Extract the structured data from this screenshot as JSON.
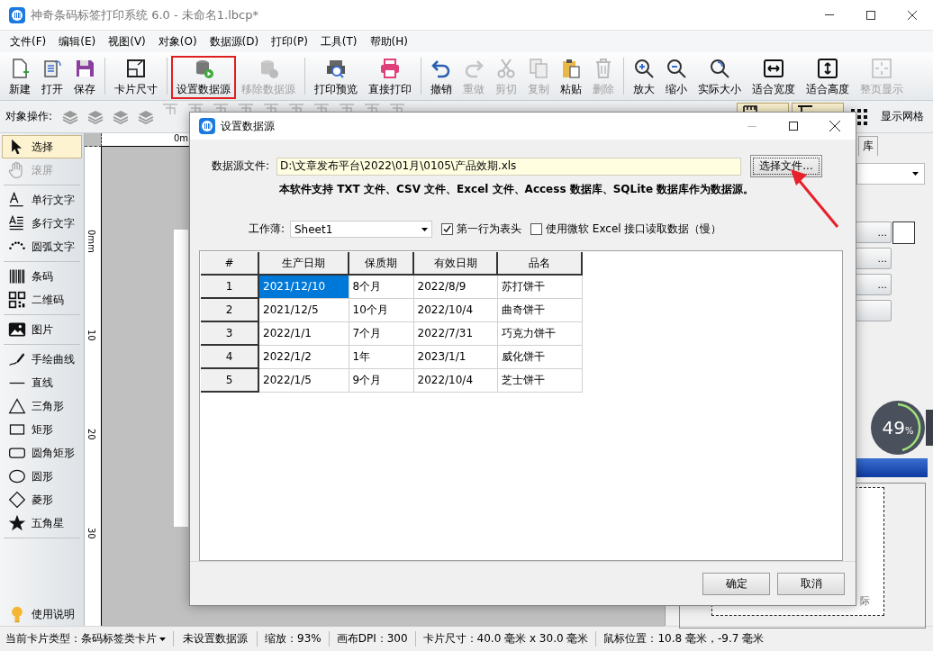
{
  "window": {
    "title": "神奇条码标签打印系统 6.0 - 未命名1.lbcp*"
  },
  "menu": [
    "文件(F)",
    "编辑(E)",
    "视图(V)",
    "对象(O)",
    "数据源(D)",
    "打印(P)",
    "工具(T)",
    "帮助(H)"
  ],
  "toolbar": {
    "groups": [
      [
        {
          "label": "新建",
          "disabled": false,
          "highlighted": false
        },
        {
          "label": "打开",
          "disabled": false,
          "highlighted": false
        },
        {
          "label": "保存",
          "disabled": false,
          "highlighted": false
        }
      ],
      [
        {
          "label": "卡片尺寸",
          "disabled": false,
          "highlighted": false
        }
      ],
      [
        {
          "label": "设置数据源",
          "disabled": false,
          "highlighted": true
        },
        {
          "label": "移除数据源",
          "disabled": true,
          "highlighted": false
        }
      ],
      [
        {
          "label": "打印预览",
          "disabled": false,
          "highlighted": false
        },
        {
          "label": "直接打印",
          "disabled": false,
          "highlighted": false
        }
      ],
      [
        {
          "label": "撤销",
          "disabled": false,
          "highlighted": false
        },
        {
          "label": "重做",
          "disabled": true,
          "highlighted": false
        },
        {
          "label": "剪切",
          "disabled": true,
          "highlighted": false
        },
        {
          "label": "复制",
          "disabled": true,
          "highlighted": false
        },
        {
          "label": "粘贴",
          "disabled": false,
          "highlighted": false
        },
        {
          "label": "删除",
          "disabled": true,
          "highlighted": false
        }
      ],
      [
        {
          "label": "放大",
          "disabled": false,
          "highlighted": false
        },
        {
          "label": "缩小",
          "disabled": false,
          "highlighted": false
        },
        {
          "label": "实际大小",
          "disabled": false,
          "highlighted": false
        },
        {
          "label": "适合宽度",
          "disabled": false,
          "highlighted": false
        },
        {
          "label": "适合高度",
          "disabled": false,
          "highlighted": false
        },
        {
          "label": "整页显示",
          "disabled": true,
          "highlighted": false
        }
      ]
    ]
  },
  "object_bar": {
    "label": "对象操作:",
    "toggles": [
      {
        "on": true
      },
      {
        "on": true
      }
    ],
    "grid_toggle": {
      "label": "显示网格",
      "on": false
    }
  },
  "tools": {
    "groups": [
      [
        {
          "label": "选择",
          "selected": true,
          "disabled": false
        },
        {
          "label": "滚屏",
          "selected": false,
          "disabled": true
        }
      ],
      [
        {
          "label": "单行文字",
          "selected": false,
          "disabled": false
        },
        {
          "label": "多行文字",
          "selected": false,
          "disabled": false
        },
        {
          "label": "圆弧文字",
          "selected": false,
          "disabled": false
        }
      ],
      [
        {
          "label": "条码",
          "selected": false,
          "disabled": false
        },
        {
          "label": "二维码",
          "selected": false,
          "disabled": false
        }
      ],
      [
        {
          "label": "图片",
          "selected": false,
          "disabled": false
        }
      ],
      [
        {
          "label": "手绘曲线",
          "selected": false,
          "disabled": false
        },
        {
          "label": "直线",
          "selected": false,
          "disabled": false
        },
        {
          "label": "三角形",
          "selected": false,
          "disabled": false
        },
        {
          "label": "矩形",
          "selected": false,
          "disabled": false
        },
        {
          "label": "圆角矩形",
          "selected": false,
          "disabled": false
        },
        {
          "label": "圆形",
          "selected": false,
          "disabled": false
        },
        {
          "label": "菱形",
          "selected": false,
          "disabled": false
        },
        {
          "label": "五角星",
          "selected": false,
          "disabled": false
        }
      ]
    ],
    "help": "使用说明"
  },
  "ruler": {
    "top_label": "0m",
    "side_labels": [
      "0mm",
      "10",
      "20",
      "30"
    ]
  },
  "right_panel": {
    "tab": "库",
    "buttons": [
      "...",
      "...",
      "..."
    ],
    "preview_text": "际"
  },
  "net_monitor": {
    "value": "49",
    "unit": "%"
  },
  "dialog": {
    "title": "设置数据源",
    "file_label": "数据源文件:",
    "file_path": "D:\\文章发布平台\\2022\\01月\\0105\\产品效期.xls",
    "choose_button": "选择文件...",
    "note": "本软件支持 TXT 文件、CSV 文件、Excel 文件、Access 数据库、SQLite 数据库作为数据源。",
    "workbook_label": "工作薄:",
    "workbook": "Sheet1",
    "options": [
      {
        "label": "第一行为表头",
        "checked": true
      },
      {
        "label": "使用微软 Excel 接口读取数据（慢）",
        "checked": false
      }
    ],
    "table": {
      "columns": [
        "#",
        "生产日期",
        "保质期",
        "有效日期",
        "品名"
      ],
      "rows": [
        {
          "cells": [
            {
              "text": "1",
              "selected": false
            },
            {
              "text": "2021/12/10",
              "selected": true
            },
            {
              "text": "8个月",
              "selected": false
            },
            {
              "text": "2022/8/9",
              "selected": false
            },
            {
              "text": "苏打饼干",
              "selected": false
            }
          ]
        },
        {
          "cells": [
            {
              "text": "2",
              "selected": false
            },
            {
              "text": "2021/12/5",
              "selected": false
            },
            {
              "text": "10个月",
              "selected": false
            },
            {
              "text": "2022/10/4",
              "selected": false
            },
            {
              "text": "曲奇饼干",
              "selected": false
            }
          ]
        },
        {
          "cells": [
            {
              "text": "3",
              "selected": false
            },
            {
              "text": "2022/1/1",
              "selected": false
            },
            {
              "text": "7个月",
              "selected": false
            },
            {
              "text": "2022/7/31",
              "selected": false
            },
            {
              "text": "巧克力饼干",
              "selected": false
            }
          ]
        },
        {
          "cells": [
            {
              "text": "4",
              "selected": false
            },
            {
              "text": "2022/1/2",
              "selected": false
            },
            {
              "text": "1年",
              "selected": false
            },
            {
              "text": "2023/1/1",
              "selected": false
            },
            {
              "text": "威化饼干",
              "selected": false
            }
          ]
        },
        {
          "cells": [
            {
              "text": "5",
              "selected": false
            },
            {
              "text": "2022/1/5",
              "selected": false
            },
            {
              "text": "9个月",
              "selected": false
            },
            {
              "text": "2022/10/4",
              "selected": false
            },
            {
              "text": "芝士饼干",
              "selected": false
            }
          ]
        }
      ]
    },
    "buttons": [
      "确定",
      "取消"
    ]
  },
  "status_bar": {
    "card_type": "当前卡片类型：条码标签类卡片",
    "items": [
      "未设置数据源",
      "缩放：93%",
      "画布DPI：300",
      "卡片尺寸：40.0 毫米 x 30.0 毫米",
      "鼠标位置：10.8 毫米，-9.7 毫米"
    ]
  }
}
